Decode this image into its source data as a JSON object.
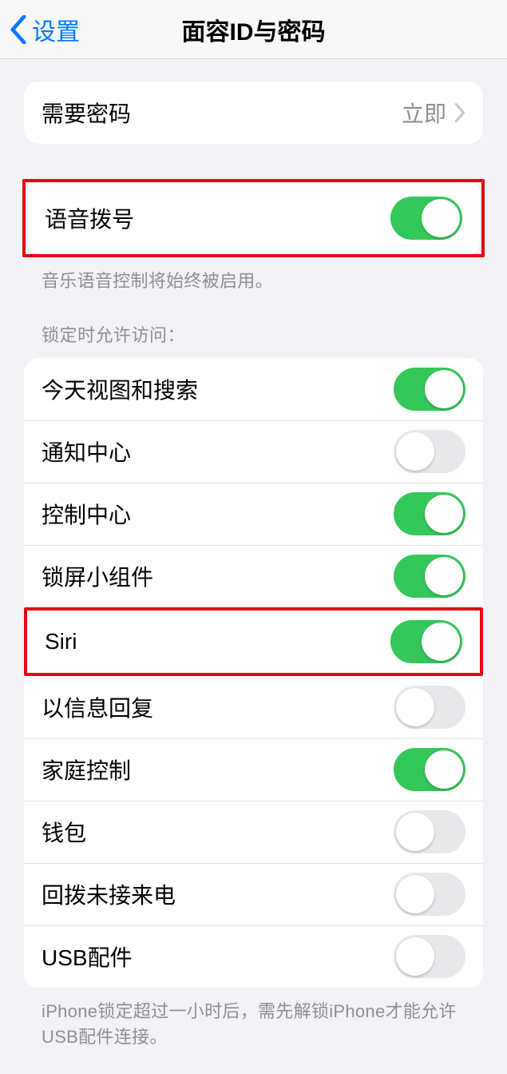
{
  "nav": {
    "back": "设置",
    "title": "面容ID与密码"
  },
  "require_passcode": {
    "label": "需要密码",
    "value": "立即"
  },
  "voice_dial": {
    "label": "语音拨号",
    "on": true,
    "footer": "音乐语音控制将始终被启用。"
  },
  "lock_section": {
    "header": "锁定时允许访问：",
    "items": [
      {
        "label": "今天视图和搜索",
        "on": true
      },
      {
        "label": "通知中心",
        "on": false
      },
      {
        "label": "控制中心",
        "on": true
      },
      {
        "label": "锁屏小组件",
        "on": true
      },
      {
        "label": "Siri",
        "on": true
      },
      {
        "label": "以信息回复",
        "on": false
      },
      {
        "label": "家庭控制",
        "on": true
      },
      {
        "label": "钱包",
        "on": false
      },
      {
        "label": "回拨未接来电",
        "on": false
      },
      {
        "label": "USB配件",
        "on": false
      }
    ],
    "footer": "iPhone锁定超过一小时后，需先解锁iPhone才能允许USB配件连接。"
  }
}
